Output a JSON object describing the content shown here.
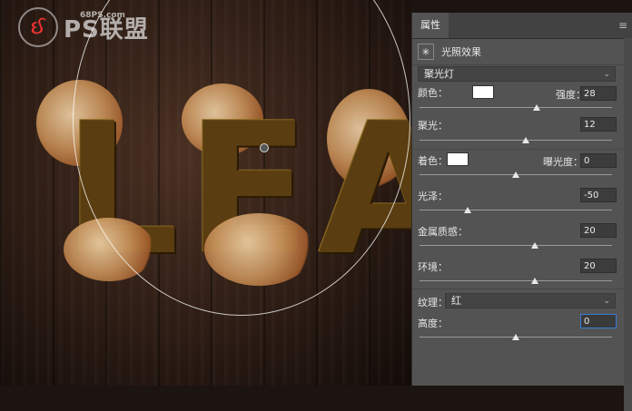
{
  "watermark": {
    "brand": "PS联盟",
    "url": "68PS.com",
    "logo_glyph": "ઈ"
  },
  "artwork": {
    "letters": [
      "L",
      "E",
      "A"
    ]
  },
  "panel": {
    "tab": "属性",
    "menu_glyph": "≡",
    "effect_icon": "✳",
    "effect_title": "光照效果",
    "light_type": "聚光灯",
    "color_label": "颜色：",
    "intensity_label": "强度：",
    "intensity_value": "28",
    "intensity_level": 0.61,
    "hotspot_label": "聚光：",
    "hotspot_value": "12",
    "hotspot_level": 0.55,
    "colorize_label": "着色：",
    "exposure_label": "曝光度：",
    "exposure_value": "0",
    "exposure_level": 0.5,
    "gloss_label": "光泽：",
    "gloss_value": "-50",
    "gloss_level": 0.25,
    "metallic_label": "金属质感：",
    "metallic_value": "20",
    "metallic_level": 0.6,
    "ambience_label": "环境：",
    "ambience_value": "20",
    "ambience_level": 0.6,
    "texture_label": "纹理：",
    "texture_value": "红",
    "height_label": "高度：",
    "height_value": "0",
    "height_level": 0.5,
    "chevron": "⌄"
  }
}
